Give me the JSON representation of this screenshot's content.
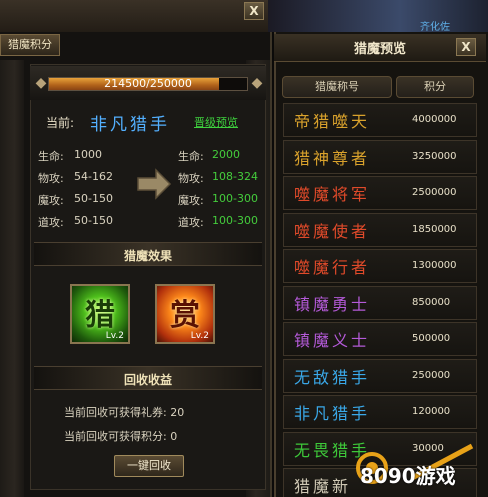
{
  "window": {
    "close_label": "X",
    "scene_text": "齐化佐"
  },
  "left_panel": {
    "tab_label": "猎魔积分",
    "progress": {
      "text": "214500/250000",
      "current": 214500,
      "max": 250000
    },
    "current_label": "当前:",
    "current_title": "非凡猎手",
    "upgrade_link": "晋级预览",
    "stats_current": [
      {
        "label": "生命:",
        "value": "1000"
      },
      {
        "label": "物攻:",
        "value": "54-162"
      },
      {
        "label": "魔攻:",
        "value": "50-150"
      },
      {
        "label": "道攻:",
        "value": "50-150"
      }
    ],
    "stats_next": [
      {
        "label": "生命:",
        "value": "2000"
      },
      {
        "label": "物攻:",
        "value": "108-324"
      },
      {
        "label": "魔攻:",
        "value": "100-300"
      },
      {
        "label": "道攻:",
        "value": "100-300"
      }
    ],
    "effects_title": "猎魔效果",
    "skills": [
      {
        "glyph": "猎",
        "level": "Lv.2"
      },
      {
        "glyph": "赏",
        "level": "Lv.2"
      }
    ],
    "recycle_title": "回收收益",
    "recycle_coupon": "当前回收可获得礼券: 20",
    "recycle_points": "当前回收可获得积分: 0",
    "recycle_button": "一键回收"
  },
  "right_panel": {
    "title": "猎魔预览",
    "close_label": "X",
    "col_name": "猎魔称号",
    "col_score": "积分",
    "ranks": [
      {
        "name": "帝猎噬天",
        "score": "4000000",
        "color": "#d9a22c"
      },
      {
        "name": "猎神尊者",
        "score": "3250000",
        "color": "#d9a22c"
      },
      {
        "name": "噬魔将军",
        "score": "2500000",
        "color": "#e04a2a"
      },
      {
        "name": "噬魔使者",
        "score": "1850000",
        "color": "#e04a2a"
      },
      {
        "name": "噬魔行者",
        "score": "1300000",
        "color": "#e04a2a"
      },
      {
        "name": "镇魔勇士",
        "score": "850000",
        "color": "#b45ad8"
      },
      {
        "name": "镇魔义士",
        "score": "500000",
        "color": "#b45ad8"
      },
      {
        "name": "无敌猎手",
        "score": "250000",
        "color": "#3aa8e8"
      },
      {
        "name": "非凡猎手",
        "score": "120000",
        "color": "#3aa8e8"
      },
      {
        "name": "无畏猎手",
        "score": "30000",
        "color": "#3ec93a"
      },
      {
        "name": "猎魔新",
        "score": "",
        "color": "#cfc8b4"
      }
    ]
  },
  "watermark": {
    "text": "8090游戏"
  }
}
